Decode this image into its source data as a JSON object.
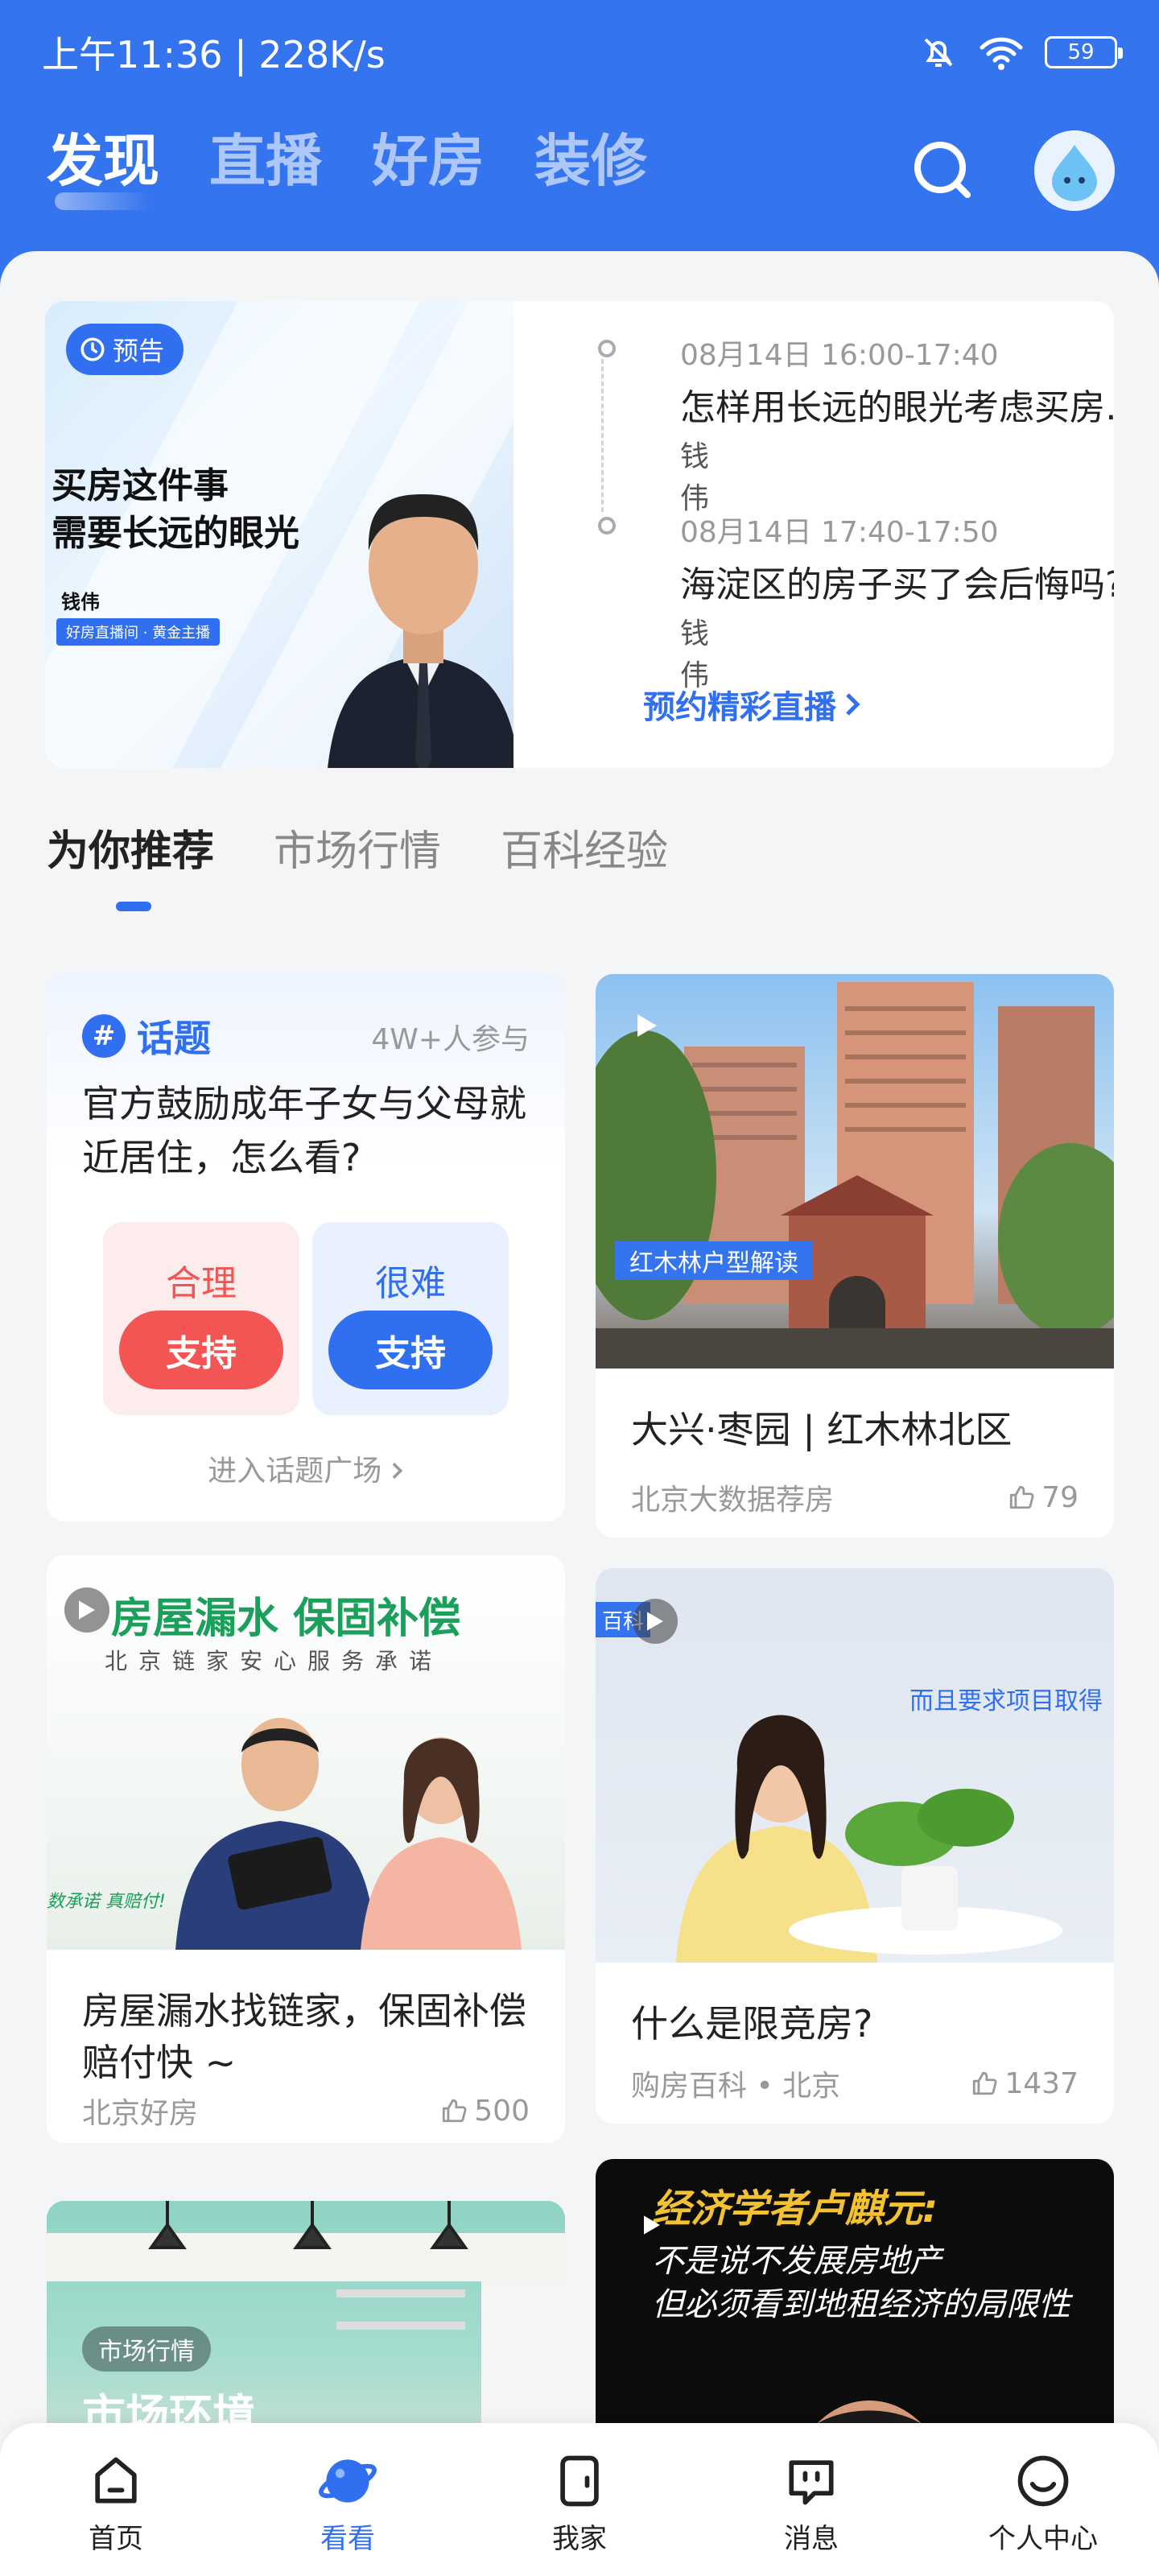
{
  "status_bar": {
    "time": "上午11:36 | 228K/s",
    "battery": "59"
  },
  "top_tabs": [
    {
      "label": "发现",
      "active": true
    },
    {
      "label": "直播",
      "active": false
    },
    {
      "label": "好房",
      "active": false
    },
    {
      "label": "装修",
      "active": false
    }
  ],
  "live": {
    "badge": "预告",
    "poster_title_line1": "买房这件事",
    "poster_title_line2": "需要长远的眼光",
    "poster_name": "钱伟",
    "poster_role": "好房直播间 · 黄金主播",
    "schedule": [
      {
        "time": "08月14日 16:00-17:40",
        "title": "怎样用长远的眼光考虑买房…",
        "host": "钱伟"
      },
      {
        "time": "08月14日 17:40-17:50",
        "title": "海淀区的房子买了会后悔吗?",
        "host": "钱伟"
      }
    ],
    "book_label": "预约精彩直播"
  },
  "sub_tabs": [
    {
      "label": "为你推荐",
      "active": true
    },
    {
      "label": "市场行情",
      "active": false
    },
    {
      "label": "百科经验",
      "active": false
    }
  ],
  "topic": {
    "label": "话题",
    "count": "4W+人参与",
    "question": "官方鼓励成年子女与父母就近居住，怎么看?",
    "option_a": "合理",
    "option_b": "很难",
    "support": "支持",
    "link": "进入话题广场"
  },
  "cards": {
    "hongmulin": {
      "overlay": "红木林户型解读",
      "title": "大兴·枣园 | 红木林北区",
      "source": "北京大数据荐房",
      "likes": "79"
    },
    "leak": {
      "banner_title": "房屋漏水 保固补偿",
      "banner_sub": "北京链家安心服务承诺",
      "side_text": "数承诺 真赔付!",
      "title": "房屋漏水找链家，保固补偿赔付快 ~",
      "source": "北京好房",
      "likes": "500"
    },
    "xianjing": {
      "tag": "百科",
      "caption": "而且要求项目取得",
      "title": "什么是限竞房?",
      "source": "购房百科 • 北京",
      "likes": "1437"
    },
    "market": {
      "tag": "市场行情",
      "title": "市场环境"
    },
    "economist": {
      "line1": "经济学者卢麒元:",
      "line2": "不是说不发展房地产",
      "line3": "但必须看到地租经济的局限性"
    }
  },
  "bottom_nav": [
    {
      "label": "首页",
      "icon": "home-icon",
      "active": false
    },
    {
      "label": "看看",
      "icon": "planet-icon",
      "active": true
    },
    {
      "label": "我家",
      "icon": "door-icon",
      "active": false
    },
    {
      "label": "消息",
      "icon": "message-icon",
      "active": false
    },
    {
      "label": "个人中心",
      "icon": "smile-icon",
      "active": false
    }
  ],
  "colors": {
    "brand": "#3474ee",
    "accent": "#2f6ff0",
    "agree": "#f35454",
    "disagree": "#2f6ff0"
  }
}
